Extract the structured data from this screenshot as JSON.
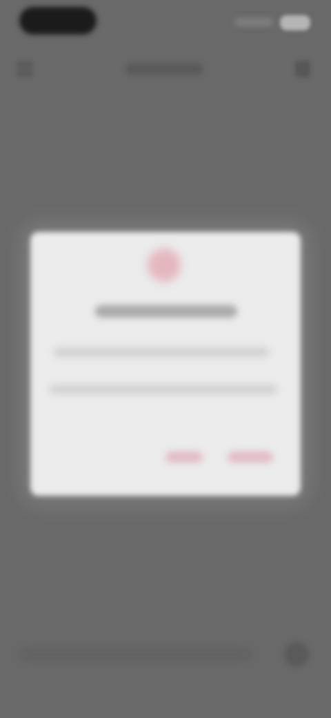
{
  "app_bar": {
    "title": ""
  },
  "dialog": {
    "title": "",
    "line1": "",
    "line2": "",
    "cancel_label": "",
    "confirm_label": ""
  },
  "input": {
    "placeholder": ""
  },
  "colors": {
    "background": "#696969",
    "dialog_surface": "#ebebeb",
    "accent": "#e1bcc3"
  },
  "icons": {
    "back": "arrow-left-icon",
    "menu": "more-vertical-icon",
    "alert": "alert-circle-icon",
    "send": "send-icon"
  }
}
